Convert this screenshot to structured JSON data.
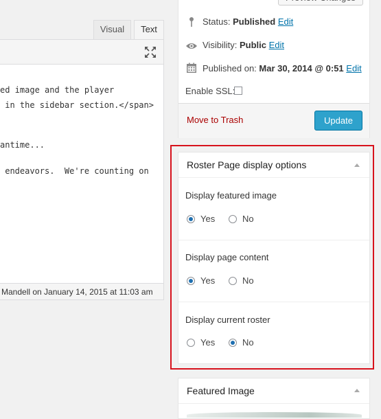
{
  "editor": {
    "tabs": [
      {
        "label": "Visual"
      },
      {
        "label": "Text"
      }
    ],
    "code_lines": [
      "ed image and the player",
      " in the sidebar section.</span>",
      "",
      "antime...",
      "",
      " endeavors.  We're counting on"
    ],
    "last_edited": "Mandell on January 14, 2015 at 11:03 am"
  },
  "publish": {
    "preview_label": "Preview Changes",
    "status_label": "Status:",
    "status_value": "Published",
    "visibility_label": "Visibility:",
    "visibility_value": "Public",
    "published_label": "Published on:",
    "published_value": "Mar 30, 2014 @ 0:51",
    "edit_label": "Edit",
    "ssl_label": "Enable SSL:",
    "trash_label": "Move to Trash",
    "update_label": "Update"
  },
  "roster_options": {
    "title": "Roster Page display options",
    "groups": [
      {
        "label": "Display featured image",
        "yes_label": "Yes",
        "no_label": "No",
        "selected": "Yes"
      },
      {
        "label": "Display page content",
        "yes_label": "Yes",
        "no_label": "No",
        "selected": "Yes"
      },
      {
        "label": "Display current roster",
        "yes_label": "Yes",
        "no_label": "No",
        "selected": "No"
      }
    ]
  },
  "featured_image": {
    "title": "Featured Image"
  },
  "colors": {
    "link": "#0073aa",
    "trash": "#aa0000",
    "update_button": "#2ea2cc",
    "highlight_border": "#d7121c"
  },
  "icons": {
    "expand": "expand-icon",
    "status": "pin-icon",
    "visibility": "eye-icon",
    "published": "calendar-icon",
    "toggle": "chevron-up-icon"
  }
}
